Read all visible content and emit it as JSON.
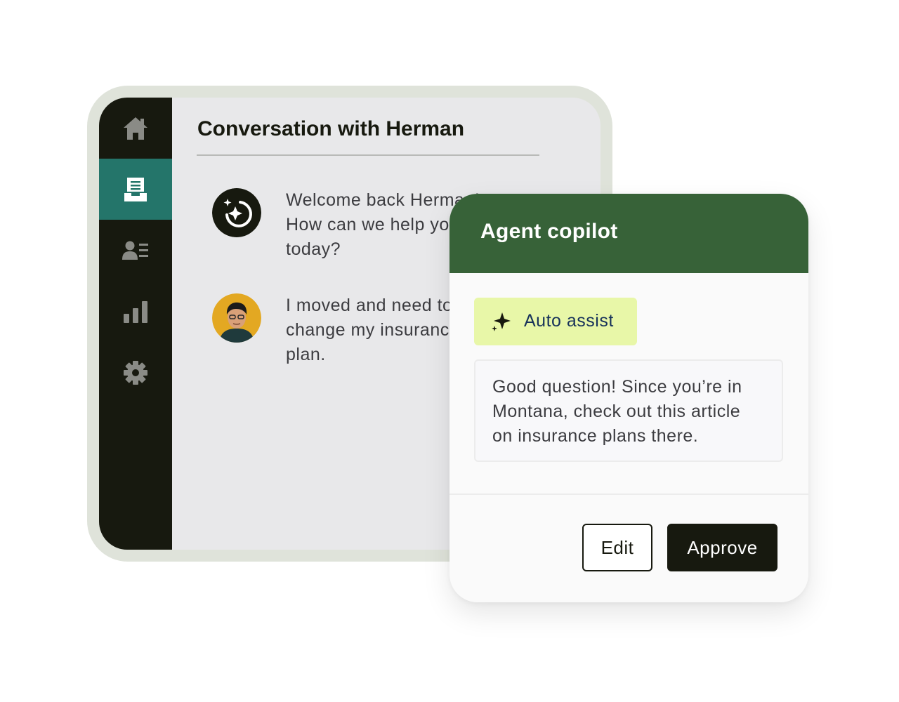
{
  "conversation": {
    "title": "Conversation with Herman",
    "messages": [
      {
        "author": "bot",
        "avatar_icon": "ai-sparkle-icon",
        "text": "Welcome back Herman! How can we help you today?"
      },
      {
        "author": "customer",
        "avatar_icon": "customer-photo",
        "text": "I moved and need to change my insurance plan."
      }
    ]
  },
  "sidebar": {
    "items": [
      {
        "icon": "home-icon",
        "active": false
      },
      {
        "icon": "inbox-icon",
        "active": true
      },
      {
        "icon": "contacts-icon",
        "active": false
      },
      {
        "icon": "bar-chart-icon",
        "active": false
      },
      {
        "icon": "gear-icon",
        "active": false
      }
    ]
  },
  "copilot": {
    "title": "Agent copilot",
    "auto_assist_label": "Auto assist",
    "suggestion": "Good question! Since you’re in Montana, check out this article on insurance plans there.",
    "edit_label": "Edit",
    "approve_label": "Approve"
  },
  "colors": {
    "sidebar_bg": "#17190f",
    "sidebar_active": "#24756a",
    "copilot_header": "#376238",
    "auto_assist_bg": "#e8f7a8"
  }
}
